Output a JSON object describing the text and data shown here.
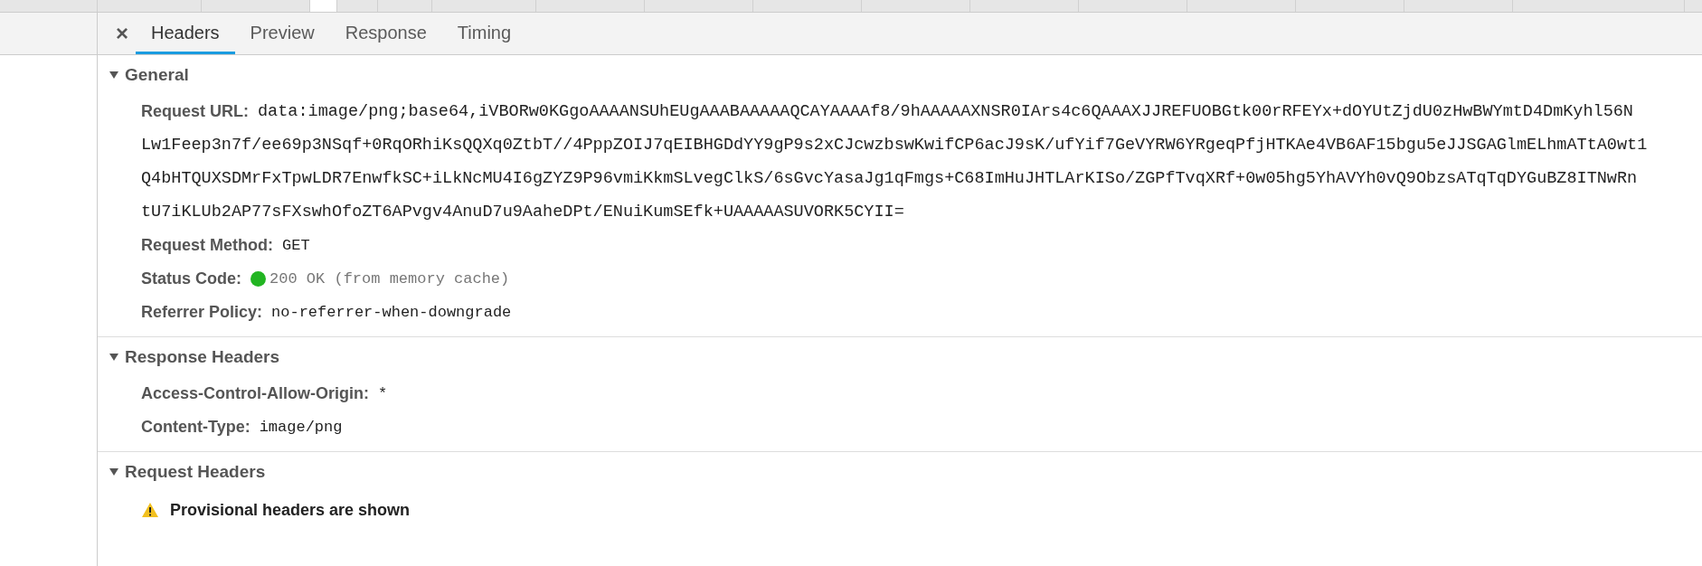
{
  "tab_bar": {
    "close": "×",
    "tabs": [
      {
        "label": "Headers",
        "selected": true
      },
      {
        "label": "Preview",
        "selected": false
      },
      {
        "label": "Response",
        "selected": false
      },
      {
        "label": "Timing",
        "selected": false
      }
    ]
  },
  "sections": [
    {
      "title": "General",
      "expanded": true,
      "rows": [
        {
          "kind": "multiline",
          "name": "Request URL:",
          "lines": [
            "data:image/png;base64,iVBORw0KGgoAAAANSUhEUgAAABAAAAAQCAYAAAAf8/9hAAAAAXNSR0IArs4c6QAAAXJJREFUOBGtk00rRFEYx+dOYUtZjdU0zHwBWYmtD4DmKyhl56N",
            "Lw1Feep3n7f/ee69p3NSqf+0RqORhiKsQQXq0ZtbT//4PppZOIJ7qEIBHGDdYY9gP9s2xCJcwzbswKwifCP6acJ9sK/ufYif7GeVYRW6YRgeqPfjHTKAe4VB6AF15bgu5eJJSGAGlmELhmATtA0wt1",
            "Q4bHTQUXSDMrFxTpwLDR7EnwfkSC+iLkNcMU4I6gZYZ9P96vmiKkmSLvegClkS/6sGvcYasaJg1qFmgs+C68ImHuJHTLArKISo/ZGPfTvqXRf+0w05hg5YhAVYh0vQ9ObzsATqTqDYGuBZ8ITNwRn",
            "tU7iKLUb2AP77sFXswhOfoZT6APvgv4AnuD7u9AaheDPt/ENuiKumSEfk+UAAAAASUVORK5CYII="
          ]
        },
        {
          "kind": "plain",
          "name": "Request Method:",
          "value": "GET"
        },
        {
          "kind": "status",
          "name": "Status Code:",
          "value": "200 OK (from memory cache)",
          "color": "#22b522"
        },
        {
          "kind": "plain",
          "name": "Referrer Policy:",
          "value": "no-referrer-when-downgrade"
        }
      ]
    },
    {
      "title": "Response Headers",
      "expanded": true,
      "rows": [
        {
          "kind": "plain",
          "name": "Access-Control-Allow-Origin:",
          "value": "*"
        },
        {
          "kind": "plain",
          "name": "Content-Type:",
          "value": "image/png"
        }
      ]
    },
    {
      "title": "Request Headers",
      "expanded": true,
      "rows": [
        {
          "kind": "warning",
          "value": "Provisional headers are shown"
        }
      ]
    }
  ]
}
